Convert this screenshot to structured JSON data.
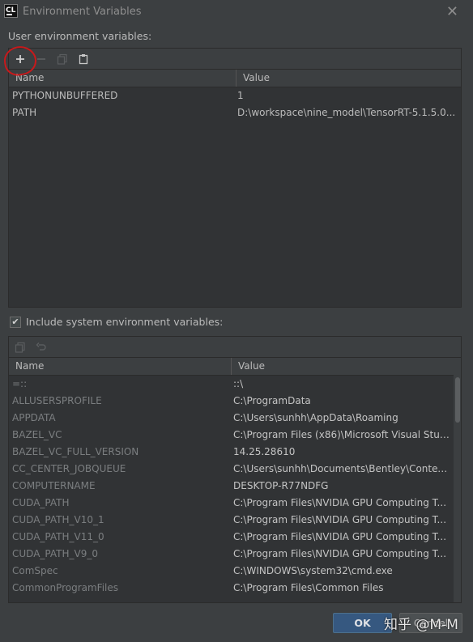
{
  "window": {
    "title": "Environment Variables",
    "app_icon_text": "CL"
  },
  "user_section": {
    "label": "User environment variables:",
    "columns": [
      "Name",
      "Value"
    ],
    "rows": [
      {
        "name": "PYTHONUNBUFFERED",
        "value": "1"
      },
      {
        "name": "PATH",
        "value": "D:\\workspace\\nine_model\\TensorRT-5.1.5.0..."
      }
    ]
  },
  "include_system": {
    "label": "Include system environment variables:",
    "checked": true
  },
  "system_section": {
    "columns": [
      "Name",
      "Value"
    ],
    "rows": [
      {
        "name": "=::",
        "value": "::\\"
      },
      {
        "name": "ALLUSERSPROFILE",
        "value": "C:\\ProgramData"
      },
      {
        "name": "APPDATA",
        "value": "C:\\Users\\sunhh\\AppData\\Roaming"
      },
      {
        "name": "BAZEL_VC",
        "value": "C:\\Program Files (x86)\\Microsoft Visual Stud..."
      },
      {
        "name": "BAZEL_VC_FULL_VERSION",
        "value": "14.25.28610"
      },
      {
        "name": "CC_CENTER_JOBQUEUE",
        "value": "C:\\Users\\sunhh\\Documents\\Bentley\\Context..."
      },
      {
        "name": "COMPUTERNAME",
        "value": "DESKTOP-R77NDFG"
      },
      {
        "name": "CUDA_PATH",
        "value": "C:\\Program Files\\NVIDIA GPU Computing T..."
      },
      {
        "name": "CUDA_PATH_V10_1",
        "value": "C:\\Program Files\\NVIDIA GPU Computing T..."
      },
      {
        "name": "CUDA_PATH_V11_0",
        "value": "C:\\Program Files\\NVIDIA GPU Computing T..."
      },
      {
        "name": "CUDA_PATH_V9_0",
        "value": "C:\\Program Files\\NVIDIA GPU Computing T..."
      },
      {
        "name": "ComSpec",
        "value": "C:\\WINDOWS\\system32\\cmd.exe"
      },
      {
        "name": "CommonProgramFiles",
        "value": "C:\\Program Files\\Common Files"
      }
    ]
  },
  "buttons": {
    "ok": "OK",
    "cancel": "Cancel"
  },
  "watermark": "知乎 @M-M",
  "icons": {
    "add": "plus-icon",
    "remove": "minus-icon",
    "copy": "copy-icon",
    "paste": "paste-icon",
    "undo": "undo-icon",
    "close": "close-icon"
  },
  "colors": {
    "accent_button": "#365880",
    "annotation": "#c8191b",
    "background": "#3c3f41"
  }
}
